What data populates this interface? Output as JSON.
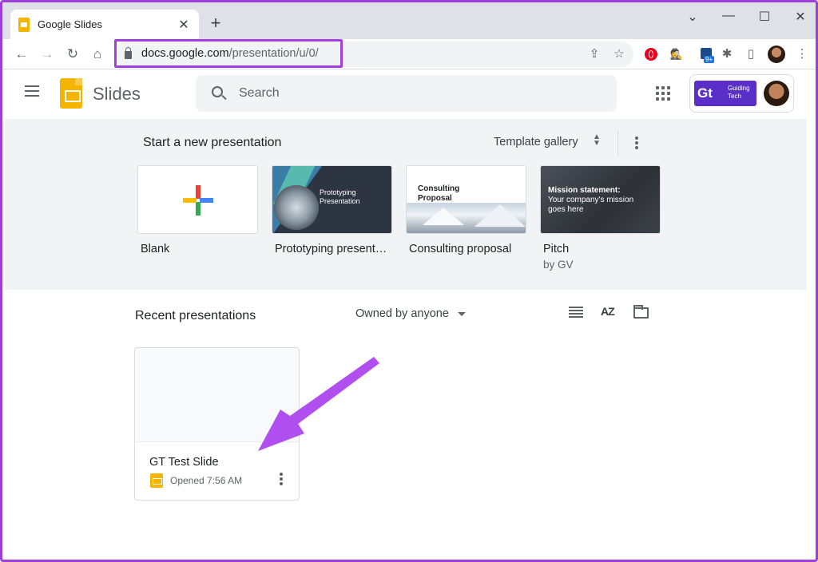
{
  "browser": {
    "tab_title": "Google Slides",
    "tab_close": "✕",
    "new_tab": "+",
    "window_controls": {
      "minimize": "—",
      "restore": "☐",
      "close": "✕",
      "tab_search": "⌄"
    },
    "url_host": "docs.google.com",
    "url_path": "/presentation/u/0/",
    "nav": {
      "back": "←",
      "forward": "→",
      "reload": "↻",
      "home": "⌂"
    },
    "toolbar_icons": {
      "share": "⇪",
      "bookmark": "☆",
      "extensions": "✱",
      "side_panel": "▯",
      "menu": "⋮"
    },
    "extension_badge": "9+"
  },
  "app": {
    "name": "Slides",
    "search_placeholder": "Search",
    "account_logo_mark": "Gt",
    "account_logo_text": "Guiding Tech"
  },
  "templates": {
    "heading": "Start a new presentation",
    "gallery_label": "Template gallery",
    "items": [
      {
        "label": "Blank",
        "sub": ""
      },
      {
        "label": "Prototyping present…",
        "sub": "",
        "thumb_text": "Prototyping Presentation"
      },
      {
        "label": "Consulting proposal",
        "sub": "",
        "thumb_text": "Consulting Proposal"
      },
      {
        "label": "Pitch",
        "sub": "by GV",
        "thumb_title": "Mission statement:",
        "thumb_body": "Your company's mission goes here"
      }
    ]
  },
  "recent": {
    "heading": "Recent presentations",
    "owner_filter": "Owned by anyone",
    "sort_label": "AZ",
    "files": [
      {
        "title": "GT Test Slide",
        "meta": "Opened 7:56 AM"
      }
    ]
  },
  "colors": {
    "highlight": "#a33fe0",
    "slides_yellow": "#f4b400",
    "arrow": "#b14ef0"
  }
}
